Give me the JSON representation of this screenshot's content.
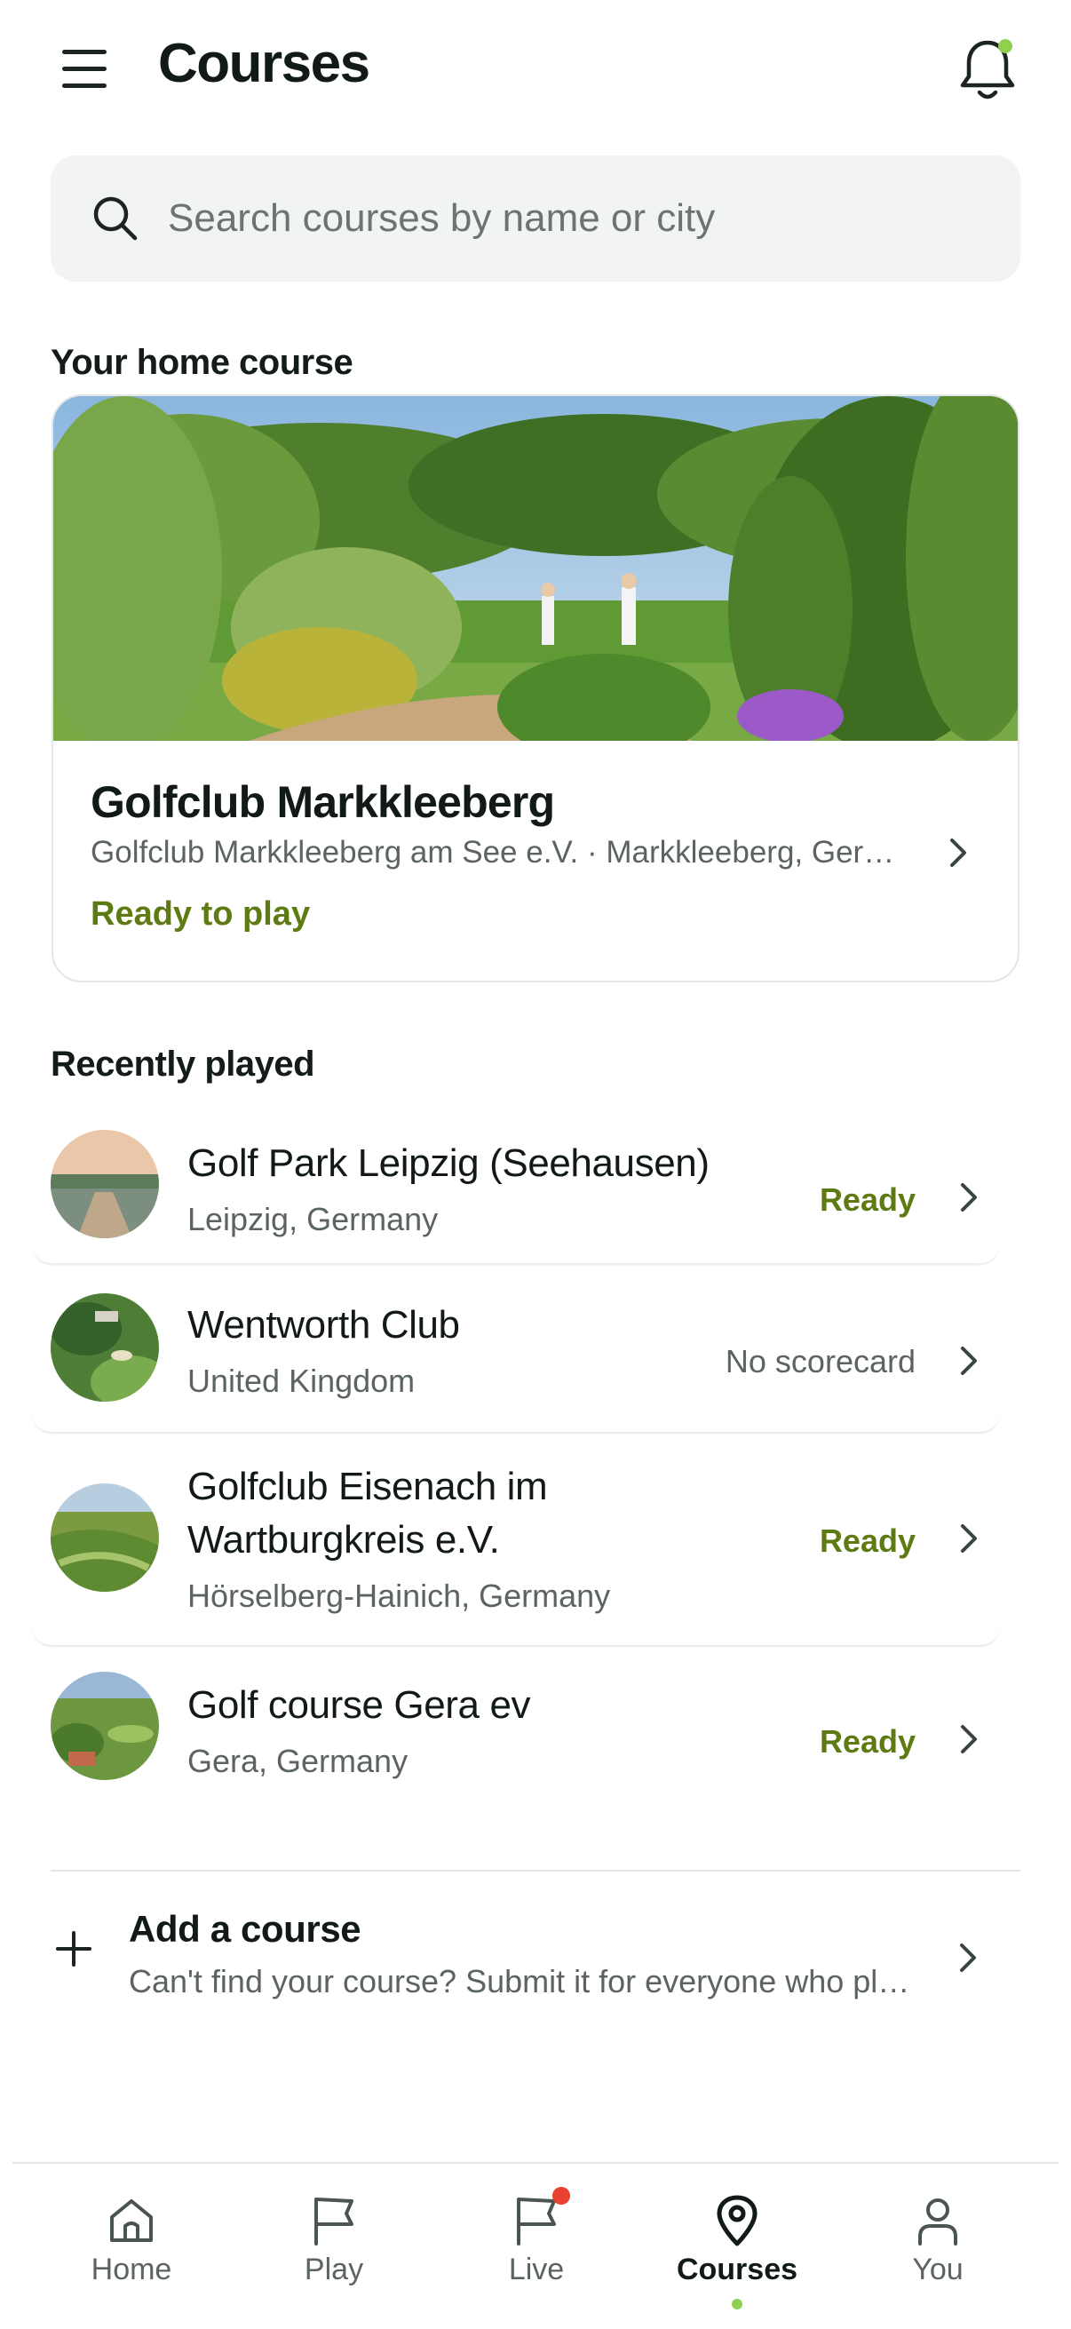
{
  "header": {
    "title": "Courses"
  },
  "search": {
    "placeholder": "Search courses by name or city"
  },
  "home": {
    "section_title": "Your home course",
    "name": "Golfclub Markkleeberg",
    "subtitle": "Golfclub Markkleeberg am See e.V. · Markkleeberg, Germany",
    "status": "Ready to play"
  },
  "recent": {
    "section_title": "Recently played",
    "items": [
      {
        "name": "Golf Park Leipzig (Seehausen)",
        "location": "Leipzig, Germany",
        "status": "Ready"
      },
      {
        "name": "Wentworth Club",
        "location": "United Kingdom",
        "status": "No scorecard"
      },
      {
        "name": "Golfclub Eisenach im Wartburgkreis e.V.",
        "location": "Hörselberg-Hainich, Germany",
        "status": "Ready"
      },
      {
        "name": "Golf course Gera ev",
        "location": "Gera, Germany",
        "status": "Ready"
      }
    ]
  },
  "add_course": {
    "title": "Add a course",
    "subtitle": "Can't find your course? Submit it for everyone who plays it."
  },
  "tabs": [
    {
      "label": "Home"
    },
    {
      "label": "Play"
    },
    {
      "label": "Live"
    },
    {
      "label": "Courses"
    },
    {
      "label": "You"
    }
  ],
  "colors": {
    "accent": "#5e7a12",
    "indicator": "#8fd14f",
    "live_badge": "#e8412f"
  }
}
